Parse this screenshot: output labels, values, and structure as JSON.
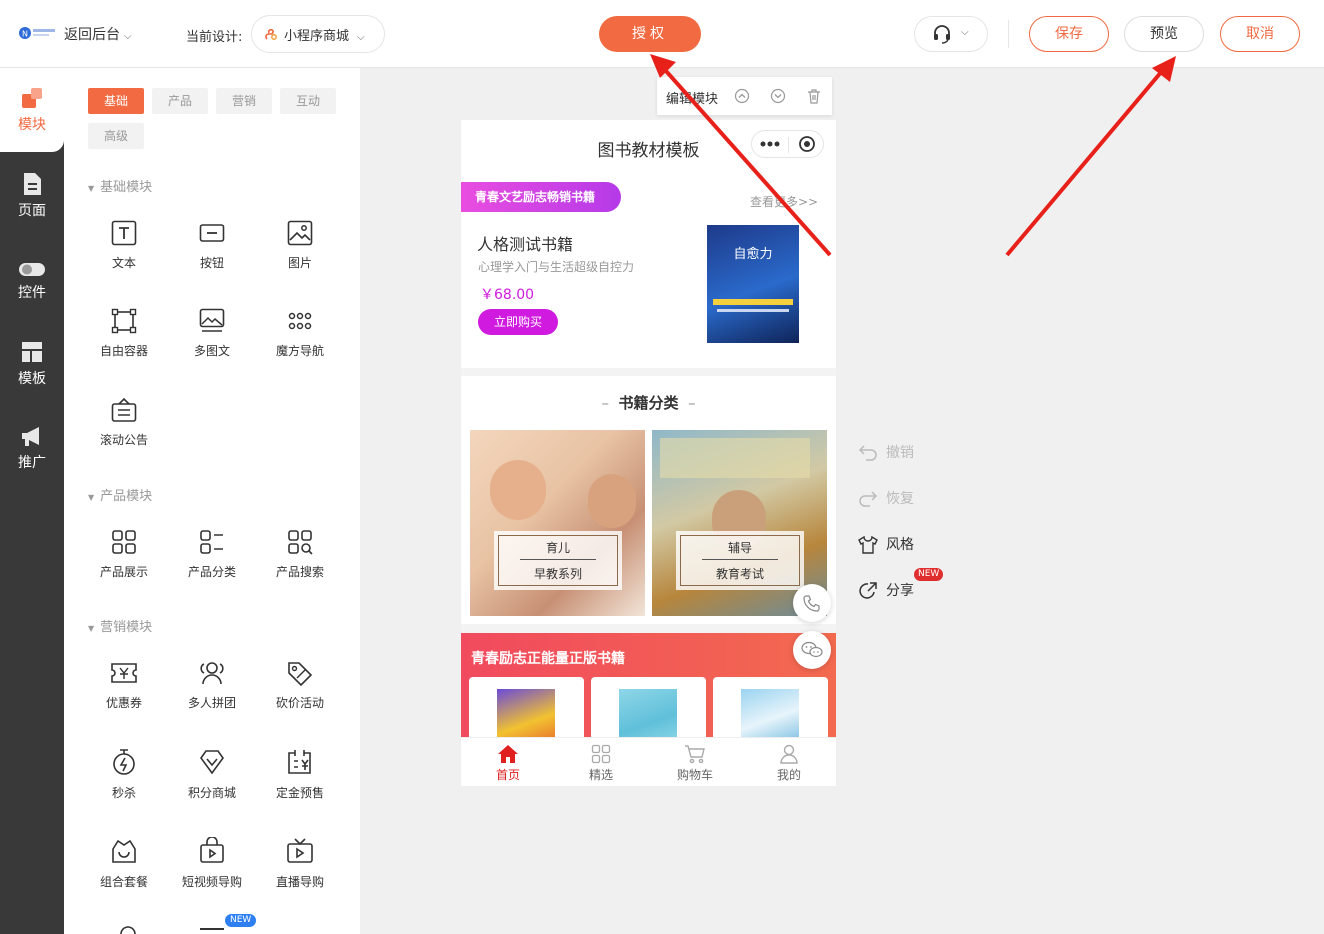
{
  "header": {
    "back_label": "返回后台",
    "current_design_label": "当前设计:",
    "design_name": "小程序商城",
    "authorize_label": "授权",
    "save_label": "保存",
    "preview_label": "预览",
    "cancel_label": "取消"
  },
  "rail": {
    "items": [
      {
        "label": "模块",
        "icon": "module-icon"
      },
      {
        "label": "页面",
        "icon": "page-icon"
      },
      {
        "label": "控件",
        "icon": "toggle-icon"
      },
      {
        "label": "模板",
        "icon": "template-icon"
      },
      {
        "label": "推广",
        "icon": "megaphone-icon"
      }
    ]
  },
  "panel": {
    "tabs": [
      "基础",
      "产品",
      "营销",
      "互动",
      "高级"
    ],
    "sections": [
      {
        "title": "基础模块",
        "items": [
          "文本",
          "按钮",
          "图片",
          "自由容器",
          "多图文",
          "魔方导航",
          "滚动公告"
        ]
      },
      {
        "title": "产品模块",
        "items": [
          "产品展示",
          "产品分类",
          "产品搜索"
        ]
      },
      {
        "title": "营销模块",
        "items": [
          "优惠券",
          "多人拼团",
          "砍价活动",
          "秒杀",
          "积分商城",
          "定金预售",
          "组合套餐",
          "短视频导购",
          "直播导购"
        ]
      }
    ],
    "new_badge": "NEW"
  },
  "editor": {
    "edit_module_label": "编辑模块"
  },
  "phone": {
    "title": "图书教材模板",
    "promo_tag": "青春文艺励志畅销书籍",
    "more_link": "查看更多>>",
    "book": {
      "name": "人格测试书籍",
      "subtitle": "心理学入门与生活超级自控力",
      "price": "￥68.00",
      "buy_label": "立即购买",
      "cover_title": "自愈力"
    },
    "category_title": "书籍分类",
    "categories": [
      {
        "title": "育儿",
        "sub": "早教系列"
      },
      {
        "title": "辅导",
        "sub": "教育考试"
      }
    ],
    "red_section_title": "青春励志正能量正版书籍",
    "tabbar": [
      "首页",
      "精选",
      "购物车",
      "我的"
    ]
  },
  "tools": {
    "undo": "撤销",
    "redo": "恢复",
    "style": "风格",
    "share": "分享",
    "share_badge": "NEW"
  },
  "colors": {
    "accent": "#f26a41",
    "rail_bg": "#393939",
    "promo_purple": "#d01adf",
    "annotation_arrow": "#e8201a"
  }
}
